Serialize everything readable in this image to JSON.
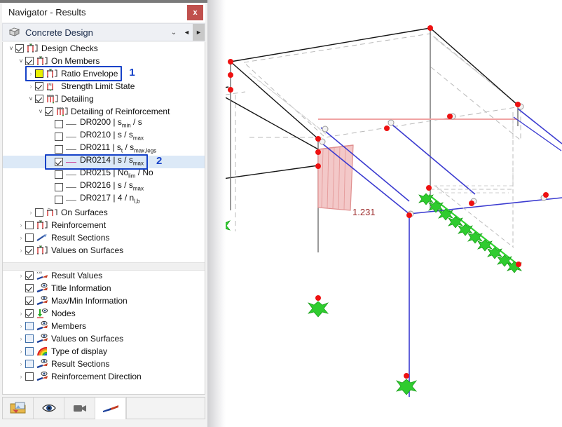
{
  "window": {
    "title": "Navigator - Results",
    "close_label": "x"
  },
  "combo": {
    "icon": "concrete-cube-icon",
    "value": "Concrete Design",
    "chevron": "⌄",
    "prev": "◄",
    "next": "►"
  },
  "tree_top": [
    {
      "id": "design-checks",
      "indent": 0,
      "expander": "open",
      "checkbox": "checked",
      "icon": "member-check-icon",
      "label": "Design Checks"
    },
    {
      "id": "on-members",
      "indent": 1,
      "expander": "open",
      "checkbox": "checked",
      "icon": "member-check-icon",
      "label": "On Members"
    },
    {
      "id": "ratio-envelope",
      "indent": 2,
      "expander": "closed",
      "checkbox": "yellow",
      "icon": "member-check-icon",
      "label": "Ratio Envelope"
    },
    {
      "id": "strength-limit-state",
      "indent": 2,
      "expander": "closed",
      "checkbox": "checked",
      "icon": "moment-check-icon",
      "label": "Strength Limit State"
    },
    {
      "id": "detailing",
      "indent": 2,
      "expander": "open",
      "checkbox": "checked",
      "icon": "detailing-icon",
      "label": "Detailing"
    },
    {
      "id": "detailing-of-reinforcement",
      "indent": 3,
      "expander": "open",
      "checkbox": "checked",
      "icon": "detailing-icon",
      "label": "Detailing of Reinforcement"
    },
    {
      "id": "dr0200",
      "indent": 4,
      "expander": "none",
      "checkbox": "unchecked",
      "icon": "line-style-grey",
      "label": "DR0200 | s<sub>min</sub> / s"
    },
    {
      "id": "dr0210",
      "indent": 4,
      "expander": "none",
      "checkbox": "unchecked",
      "icon": "line-style-grey",
      "label": "DR0210 | s / s<sub>max</sub>"
    },
    {
      "id": "dr0211",
      "indent": 4,
      "expander": "none",
      "checkbox": "unchecked",
      "icon": "line-style-grey",
      "label": "DR0211 | s<sub>t</sub> / s<sub>max,legs</sub>"
    },
    {
      "id": "dr0214",
      "indent": 4,
      "expander": "none",
      "checkbox": "checked",
      "icon": "line-style-pink",
      "label": "DR0214 | s / s<sub>max</sub>",
      "selected": true
    },
    {
      "id": "dr0215",
      "indent": 4,
      "expander": "none",
      "checkbox": "unchecked",
      "icon": "line-style-grey",
      "label": "DR0215 | No<sub>lim</sub> / No"
    },
    {
      "id": "dr0216",
      "indent": 4,
      "expander": "none",
      "checkbox": "unchecked",
      "icon": "line-style-grey",
      "label": "DR0216 | s / s<sub>max</sub>"
    },
    {
      "id": "dr0217",
      "indent": 4,
      "expander": "none",
      "checkbox": "unchecked",
      "icon": "line-style-grey",
      "label": "DR0217 | 4 / n<sub>l,b</sub>"
    },
    {
      "id": "on-surfaces",
      "indent": 2,
      "expander": "closed",
      "checkbox": "unchecked",
      "icon": "surface-check-icon",
      "label": "On Surfaces"
    },
    {
      "id": "reinforcement",
      "indent": 1,
      "expander": "closed",
      "checkbox": "unchecked",
      "icon": "member-check-icon",
      "label": "Reinforcement"
    },
    {
      "id": "result-sections-top",
      "indent": 1,
      "expander": "closed",
      "checkbox": "unchecked",
      "icon": "result-section-icon",
      "label": "Result Sections"
    },
    {
      "id": "values-on-surfaces-top",
      "indent": 1,
      "expander": "closed",
      "checkbox": "checked",
      "icon": "member-check-icon",
      "label": "Values on Surfaces"
    }
  ],
  "tree_bottom": [
    {
      "id": "result-values",
      "indent": 1,
      "expander": "closed",
      "checkbox": "checked",
      "icon": "result-values-icon",
      "label": "Result Values"
    },
    {
      "id": "title-information",
      "indent": 1,
      "expander": "none",
      "checkbox": "checked",
      "icon": "display-eye-icon",
      "label": "Title Information"
    },
    {
      "id": "maxmin-information",
      "indent": 1,
      "expander": "none",
      "checkbox": "checked",
      "icon": "display-eye-icon",
      "label": "Max/Min Information"
    },
    {
      "id": "nodes",
      "indent": 1,
      "expander": "closed",
      "checkbox": "checked",
      "icon": "node-arrow-icon",
      "label": "Nodes"
    },
    {
      "id": "members",
      "indent": 1,
      "expander": "closed",
      "checkbox": "blue-empty",
      "icon": "display-eye-icon",
      "label": "Members"
    },
    {
      "id": "values-on-surfaces-btm",
      "indent": 1,
      "expander": "closed",
      "checkbox": "blue-empty",
      "icon": "display-eye-icon",
      "label": "Values on Surfaces"
    },
    {
      "id": "type-of-display",
      "indent": 1,
      "expander": "closed",
      "checkbox": "blue-empty",
      "icon": "rainbow-icon",
      "label": "Type of display"
    },
    {
      "id": "result-sections-btm",
      "indent": 1,
      "expander": "closed",
      "checkbox": "blue-empty",
      "icon": "display-eye-icon",
      "label": "Result Sections"
    },
    {
      "id": "reinforcement-direction",
      "indent": 1,
      "expander": "closed",
      "checkbox": "unchecked",
      "icon": "display-eye-icon",
      "label": "Reinforcement Direction"
    }
  ],
  "annotations": [
    {
      "id": "ann-1",
      "number": "1",
      "target": "ratio-envelope"
    },
    {
      "id": "ann-2",
      "number": "2",
      "target": "dr0214"
    }
  ],
  "toolbar": [
    {
      "id": "project-navigator",
      "icon": "folder-image-icon",
      "active": false
    },
    {
      "id": "display-navigator",
      "icon": "eye-icon",
      "active": false
    },
    {
      "id": "views-navigator",
      "icon": "camera-icon",
      "active": false
    },
    {
      "id": "results-navigator",
      "icon": "results-arrow-icon",
      "active": true
    }
  ],
  "viewport": {
    "result_value": "1.231",
    "colors": {
      "diagram_fill": "#f3c8c8",
      "diagram_edge": "#e08f8f",
      "node_red": "#ee1111",
      "member_blue": "#3b3bd0",
      "support_green": "#22cc22",
      "value_text": "#9c2b2b"
    }
  }
}
